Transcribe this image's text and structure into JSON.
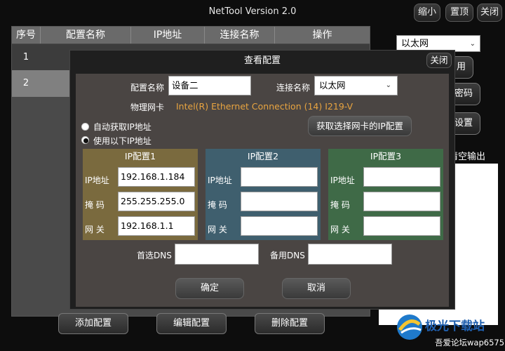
{
  "window": {
    "title": "NetTool Version 2.0",
    "minimize_label": "缩小",
    "pin_label": "置顶",
    "close_label": "关闭"
  },
  "table": {
    "columns": [
      "序号",
      "配置名称",
      "IP地址",
      "连接名称",
      "操作"
    ],
    "rows": [
      {
        "index": "1"
      },
      {
        "index": "2"
      }
    ],
    "add_label": "添加配置",
    "edit_label": "编辑配置",
    "delete_label": "删除配置"
  },
  "right_panel": {
    "adapter_select": "以太网",
    "apply_label": "用",
    "password_label": "密码",
    "settings_label": "设置",
    "clear_output_label": "清空输出"
  },
  "dialog": {
    "title": "查看配置",
    "close_label": "关闭",
    "config_name_label": "配置名称",
    "config_name_value": "设备二",
    "connection_name_label": "连接名称",
    "connection_name_value": "以太网",
    "adapter_label": "物理网卡",
    "adapter_value": "Intel(R) Ethernet Connection (14) I219-V",
    "auto_ip_label": "自动获取IP地址",
    "static_ip_label": "使用以下IP地址",
    "fetch_label": "获取选择网卡的IP配置",
    "panels": [
      {
        "title": "IP配置1",
        "ip_label": "IP地址",
        "mask_label": "掩 码",
        "gw_label": "网 关",
        "ip": "192.168.1.184",
        "mask": "255.255.255.0",
        "gw": "192.168.1.1"
      },
      {
        "title": "IP配置2",
        "ip_label": "IP地址",
        "mask_label": "掩 码",
        "gw_label": "网 关",
        "ip": "",
        "mask": "",
        "gw": ""
      },
      {
        "title": "IP配置3",
        "ip_label": "IP地址",
        "mask_label": "掩 码",
        "gw_label": "网 关",
        "ip": "",
        "mask": "",
        "gw": ""
      }
    ],
    "dns1_label": "首选DNS",
    "dns2_label": "备用DNS",
    "ok_label": "确定",
    "cancel_label": "取消"
  },
  "watermark": {
    "brand": "极光下载站",
    "caption": "吾爱论坛wap6575"
  },
  "colors": {
    "panel1": "#7a6a3e",
    "panel2": "#3f5f6e",
    "panel3": "#3f6a47",
    "accent_orange": "#e8a440"
  }
}
